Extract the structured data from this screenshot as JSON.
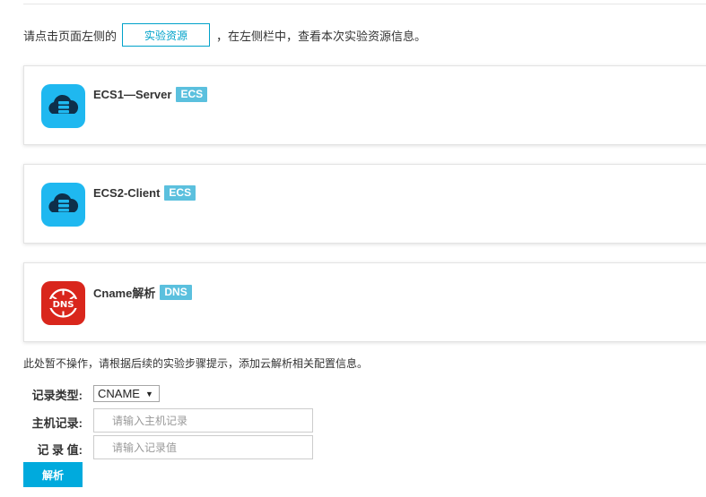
{
  "intro": {
    "prefix": "请点击页面左侧的",
    "button_label": "实验资源",
    "suffix": "，在左侧栏中，查看本次实验资源信息。"
  },
  "resources": [
    {
      "name": "ECS1—Server",
      "badge": "ECS",
      "icon": "cloud-server-icon",
      "icon_color": "#1fb8f0"
    },
    {
      "name": "ECS2-Client",
      "badge": "ECS",
      "icon": "cloud-server-icon",
      "icon_color": "#1fb8f0"
    },
    {
      "name": "Cname解析",
      "badge": "DNS",
      "icon": "dns-icon",
      "icon_color": "#d9261c"
    }
  ],
  "note": "此处暂不操作，请根据后续的实验步骤提示，添加云解析相关配置信息。",
  "form": {
    "record_type_label": "记录类型:",
    "record_type_value": "CNAME",
    "host_label": "主机记录:",
    "host_placeholder": "请输入主机记录",
    "value_label": "记 录 值:",
    "value_placeholder": "请输入记录值",
    "submit_label": "解析"
  },
  "colors": {
    "accent": "#00a2ca",
    "badge": "#5bc0de",
    "submit": "#00aadd"
  }
}
